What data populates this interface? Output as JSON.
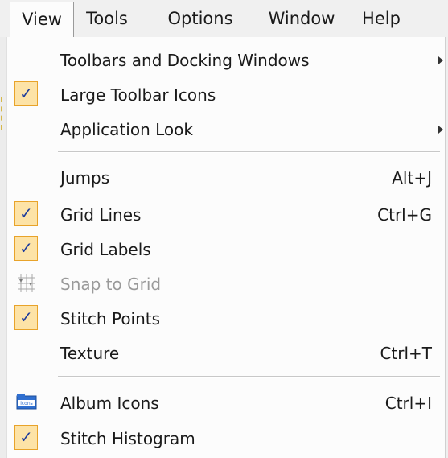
{
  "menubar": {
    "items": [
      {
        "label": "View",
        "open": true
      },
      {
        "label": "Tools"
      },
      {
        "label": "Options"
      },
      {
        "label": "Window"
      },
      {
        "label": "Help"
      }
    ]
  },
  "menu": {
    "items": [
      {
        "label": "Toolbars and Docking Windows",
        "submenu": true
      },
      {
        "label": "Large Toolbar Icons",
        "checked": true
      },
      {
        "label": "Application Look",
        "submenu": true
      },
      {
        "label": "Jumps",
        "shortcut": "Alt+J"
      },
      {
        "label": "Grid Lines",
        "shortcut": "Ctrl+G",
        "checked": true
      },
      {
        "label": "Grid Labels",
        "checked": true
      },
      {
        "label": "Snap to Grid",
        "disabled": true,
        "icon": "snap-grid-icon"
      },
      {
        "label": "Stitch Points",
        "checked": true
      },
      {
        "label": "Texture",
        "shortcut": "Ctrl+T"
      },
      {
        "label": "Album Icons",
        "shortcut": "Ctrl+I",
        "icon": "album-icons-icon",
        "icon_text": "icons"
      },
      {
        "label": "Stitch Histogram",
        "checked": true
      }
    ],
    "check_glyph": "✓"
  },
  "colors": {
    "check_fill": "#fde3a7",
    "check_border": "#e8a32a",
    "check_mark": "#1e3c9c",
    "disabled_text": "#9a9a9a"
  }
}
